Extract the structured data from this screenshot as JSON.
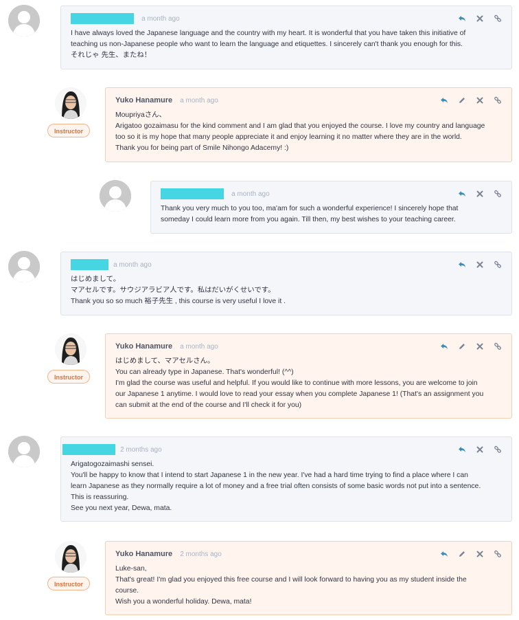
{
  "colors": {
    "mask": "#46d5e3",
    "reply": "#3a8fb8",
    "muted": "#a8b2c2",
    "instructor_bg": "#fff5ee",
    "user_bg": "#f5f6f9"
  },
  "comments": [
    {
      "time": "a month ago",
      "lines": [
        "I have always loved the Japanese language and the country with my heart. It is wonderful that you have taken this initiative of",
        "teaching us non-Japanese people who want to learn the language and etiquettes. I sincerely can't thank you enough for this.",
        "それじゃ 先生、またね！"
      ]
    },
    {
      "author": "Yuko Hanamure",
      "badge": "Instructor",
      "time": "a month ago",
      "lines": [
        "Moupriyaさん、",
        "Arigatoo gozaimasu for the kind comment and I am glad that you enjoyed the course. I love my country and language",
        "too so it is my hope that many people appreciate it and enjoy learning it no matter where they are in the world.",
        "Thank you for being part of Smile Nihongo Adacemy! :)"
      ]
    },
    {
      "time": "a month ago",
      "lines": [
        "Thank you very much to you too, ma'am for such a wonderful experience! I sincerely hope that",
        "someday I could learn more from you again. Till then, my best wishes to your teaching career."
      ]
    },
    {
      "time": "a month ago",
      "lines": [
        "はじめまして。",
        "マアセルです。サウジアラビア人です。私はだいがくせいです。",
        "Thank you so so much 裕子先生 , this course is very useful I love it ."
      ]
    },
    {
      "author": "Yuko Hanamure",
      "badge": "Instructor",
      "time": "a month ago",
      "lines": [
        "はじめまして、マアセルさん。",
        "You can already type in Japanese. That's wonderful! (^^)",
        "I'm glad the course was useful and helpful. If you would like to continue with more lessons, you are welcome to join",
        "our Japanese 1 anytime. I would love to read your essay when you complete Japanese 1! (That's an assignment you",
        "can submit at the end of the course and I'll check it for you)"
      ]
    },
    {
      "time": "2 months ago",
      "lines": [
        "Arigatogozaimashi sensei.",
        "You'll be happy to know that I intend to start Japanese 1 in the new year. I've had a hard time trying to find a place where I can",
        "learn Japanese as they normally require a lot of money and a free trial often consists of some basic words not put into a sentence.",
        "This is reassuring.",
        "See you next year, Dewa, mata."
      ]
    },
    {
      "author": "Yuko Hanamure",
      "badge": "Instructor",
      "time": "2 months ago",
      "lines": [
        "Luke-san,",
        "That's great! I'm glad you enjoyed this free course and I will look forward to having you as my student inside the",
        "course.",
        "Wish you a wonderful holiday. Dewa, mata!"
      ]
    }
  ]
}
